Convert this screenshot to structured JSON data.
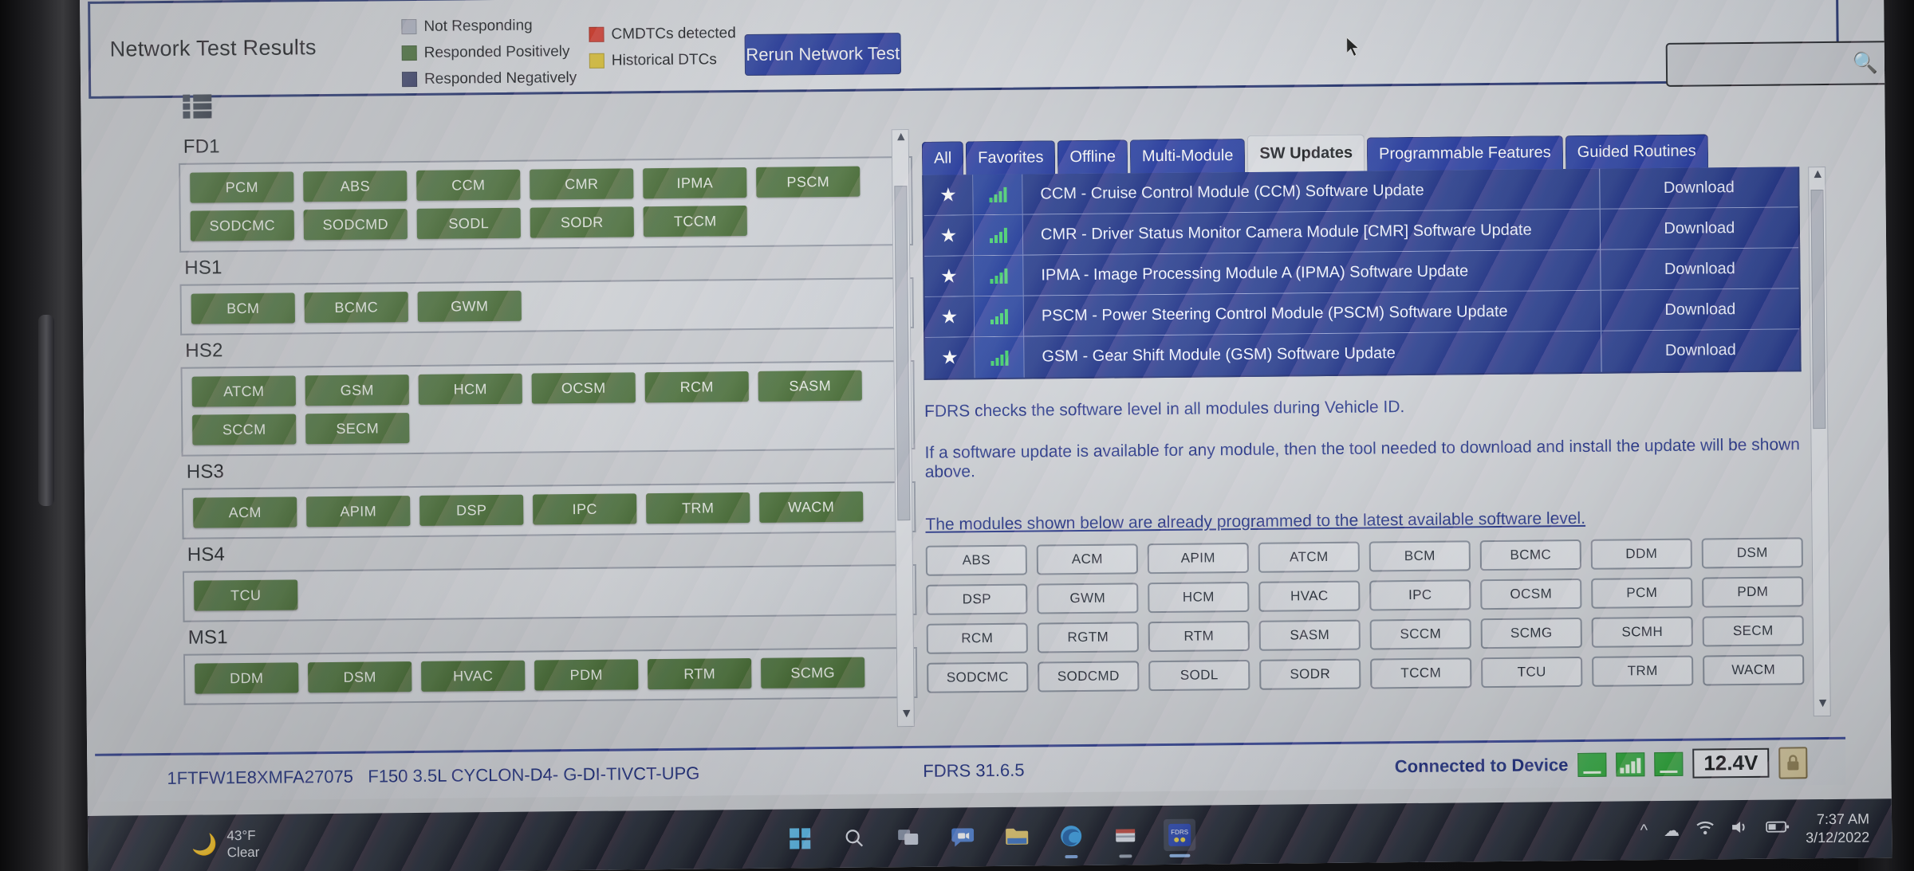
{
  "app": {
    "title": "FDRS"
  },
  "network_test": {
    "title": "Network Test Results",
    "rerun_label": "Rerun Network Test",
    "legend": [
      {
        "label": "Not Responding",
        "color": "#aeb4c4"
      },
      {
        "label": "Responded Positively",
        "color": "#456c32"
      },
      {
        "label": "Responded Negatively",
        "color": "#3a3f6b"
      },
      {
        "label": "CMDTCs detected",
        "color": "#d8301f"
      },
      {
        "label": "Historical DTCs",
        "color": "#e2c425"
      }
    ]
  },
  "search": {
    "value": "",
    "placeholder": "",
    "icon": "search-icon"
  },
  "networks": [
    {
      "name": "FD1",
      "modules": [
        "PCM",
        "ABS",
        "CCM",
        "CMR",
        "IPMA",
        "PSCM",
        "SODCMC",
        "SODCMD",
        "SODL",
        "SODR",
        "TCCM"
      ]
    },
    {
      "name": "HS1",
      "modules": [
        "BCM",
        "BCMC",
        "GWM"
      ]
    },
    {
      "name": "HS2",
      "modules": [
        "ATCM",
        "GSM",
        "HCM",
        "OCSM",
        "RCM",
        "SASM",
        "SCCM",
        "SECM"
      ]
    },
    {
      "name": "HS3",
      "modules": [
        "ACM",
        "APIM",
        "DSP",
        "IPC",
        "TRM",
        "WACM"
      ]
    },
    {
      "name": "HS4",
      "modules": [
        "TCU"
      ]
    },
    {
      "name": "MS1",
      "modules": [
        "DDM",
        "DSM",
        "HVAC",
        "PDM",
        "RTM",
        "SCMG"
      ]
    }
  ],
  "tabs": [
    {
      "label": "All",
      "active": false
    },
    {
      "label": "Favorites",
      "active": false
    },
    {
      "label": "Offline",
      "active": false
    },
    {
      "label": "Multi-Module",
      "active": false
    },
    {
      "label": "SW Updates",
      "active": true
    },
    {
      "label": "Programmable Features",
      "active": false
    },
    {
      "label": "Guided Routines",
      "active": false
    }
  ],
  "updates": {
    "action_label": "Download",
    "rows": [
      {
        "name": "CCM - Cruise Control Module (CCM) Software Update",
        "action": "Download"
      },
      {
        "name": "CMR - Driver Status Monitor Camera Module [CMR] Software Update",
        "action": "Download"
      },
      {
        "name": "IPMA - Image Processing Module A (IPMA) Software Update",
        "action": "Download"
      },
      {
        "name": "PSCM - Power Steering Control Module (PSCM) Software Update",
        "action": "Download"
      },
      {
        "name": "GSM - Gear Shift Module (GSM) Software Update",
        "action": "Download"
      }
    ]
  },
  "notes": {
    "line1": "FDRS checks the software level in all modules during Vehicle ID.",
    "line2": "If a software update is available for any module, then the tool needed to download and install the update will be shown above.",
    "link": "The modules shown below are already programmed to the latest available software level."
  },
  "programmed_modules": [
    "ABS",
    "ACM",
    "APIM",
    "ATCM",
    "BCM",
    "BCMC",
    "DDM",
    "DSM",
    "DSP",
    "GWM",
    "HCM",
    "HVAC",
    "IPC",
    "OCSM",
    "PCM",
    "PDM",
    "RCM",
    "RGTM",
    "RTM",
    "SASM",
    "SCCM",
    "SCMG",
    "SCMH",
    "SECM",
    "SODCMC",
    "SODCMD",
    "SODL",
    "SODR",
    "TCCM",
    "TCU",
    "TRM",
    "WACM"
  ],
  "statusbar": {
    "vin": "1FTFW1E8XMFA27075",
    "vehicle": "F150 3.5L CYCLON-D4- G-DI-TIVCT-UPG",
    "version": "FDRS 31.6.5",
    "connection": "Connected to Device",
    "voltage": "12.4V",
    "lock_icon": "lock-icon"
  },
  "taskbar": {
    "weather_temp": "43°F",
    "weather_cond": "Clear",
    "weather_icon": "moon-icon",
    "apps": [
      {
        "name": "start-button",
        "icon": "windows-logo-icon"
      },
      {
        "name": "search",
        "icon": "search-icon"
      },
      {
        "name": "task-view",
        "icon": "task-view-icon"
      },
      {
        "name": "chat",
        "icon": "chat-icon"
      },
      {
        "name": "file-explorer",
        "icon": "folder-icon"
      },
      {
        "name": "edge",
        "icon": "edge-icon"
      },
      {
        "name": "store",
        "icon": "store-icon"
      },
      {
        "name": "fdrs",
        "icon": "fdrs-icon"
      }
    ],
    "tray": [
      "chevron-up-icon",
      "cloud-icon",
      "wifi-icon",
      "speaker-icon",
      "battery-icon"
    ],
    "time": "7:37 AM",
    "date": "3/12/2022"
  }
}
